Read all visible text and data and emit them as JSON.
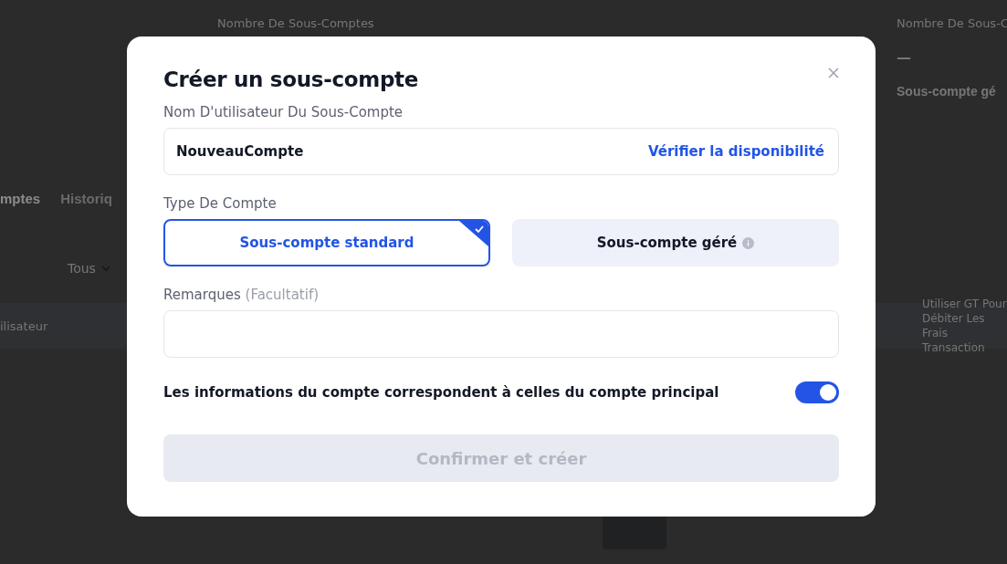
{
  "background": {
    "stats": [
      {
        "label": "Nombre De Sous-Comptes"
      },
      {
        "label": "Nombre De Sous-C",
        "value": "—",
        "type_label": "Sous-compte gé"
      }
    ],
    "tabs": [
      {
        "label": "mptes",
        "selected": true
      },
      {
        "label": "Historiq",
        "selected": false
      }
    ],
    "filter": "Tous",
    "table_columns": [
      "ilisateur",
      "Utiliser GT Pour Débiter Les Frais Transaction"
    ]
  },
  "dialog": {
    "title": "Créer un sous-compte",
    "username": {
      "label": "Nom D'utilisateur Du Sous-Compte",
      "value": "NouveauCompte",
      "action": "Vérifier la disponibilité"
    },
    "account_type": {
      "label": "Type De Compte",
      "options": [
        {
          "label": "Sous-compte standard",
          "selected": true,
          "info": false
        },
        {
          "label": "Sous-compte géré",
          "selected": false,
          "info": true
        }
      ]
    },
    "remarks": {
      "label": "Remarques",
      "optional_note": "(Facultatif)"
    },
    "sync_info": {
      "label": "Les informations du compte correspondent à celles du compte principal",
      "on": true
    },
    "confirm": {
      "label": "Confirmer et créer",
      "disabled": true
    }
  }
}
